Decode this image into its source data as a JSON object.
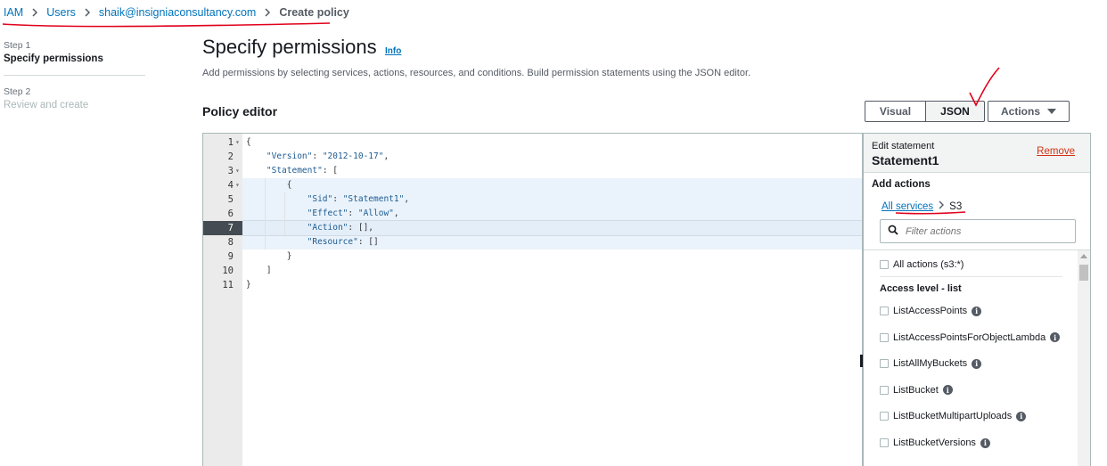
{
  "breadcrumb": {
    "items": [
      "IAM",
      "Users",
      "shaik@insigniaconsultancy.com"
    ],
    "current": "Create policy"
  },
  "steps": [
    {
      "num": "Step 1",
      "title": "Specify permissions"
    },
    {
      "num": "Step 2",
      "title": "Review and create"
    }
  ],
  "header": {
    "title": "Specify permissions",
    "info": "Info",
    "description": "Add permissions by selecting services, actions, resources, and conditions. Build permission statements using the JSON editor."
  },
  "policy_editor": {
    "heading": "Policy editor",
    "visual_label": "Visual",
    "json_label": "JSON",
    "actions_label": "Actions"
  },
  "code_lines": [
    {
      "n": "1",
      "text": "{"
    },
    {
      "n": "2",
      "text": "    \"Version\": \"2012-10-17\","
    },
    {
      "n": "3",
      "text": "    \"Statement\": ["
    },
    {
      "n": "4",
      "text": "        {"
    },
    {
      "n": "5",
      "text": "            \"Sid\": \"Statement1\","
    },
    {
      "n": "6",
      "text": "            \"Effect\": \"Allow\","
    },
    {
      "n": "7",
      "text": "            \"Action\": [],"
    },
    {
      "n": "8",
      "text": "            \"Resource\": []"
    },
    {
      "n": "9",
      "text": "        }"
    },
    {
      "n": "10",
      "text": "    ]"
    },
    {
      "n": "11",
      "text": "}"
    }
  ],
  "panel": {
    "edit_label": "Edit statement",
    "statement_name": "Statement1",
    "remove": "Remove",
    "add_actions": "Add actions",
    "all_services": "All services",
    "service": "S3",
    "filter_placeholder": "Filter actions",
    "all_actions": "All actions (s3:*)",
    "access_level": "Access level - list",
    "actions": [
      "ListAccessPoints",
      "ListAccessPointsForObjectLambda",
      "ListAllMyBuckets",
      "ListBucket",
      "ListBucketMultipartUploads",
      "ListBucketVersions"
    ]
  },
  "colors": {
    "link": "#0073bb",
    "remove": "#d13212",
    "annotation": "#e0001b"
  }
}
